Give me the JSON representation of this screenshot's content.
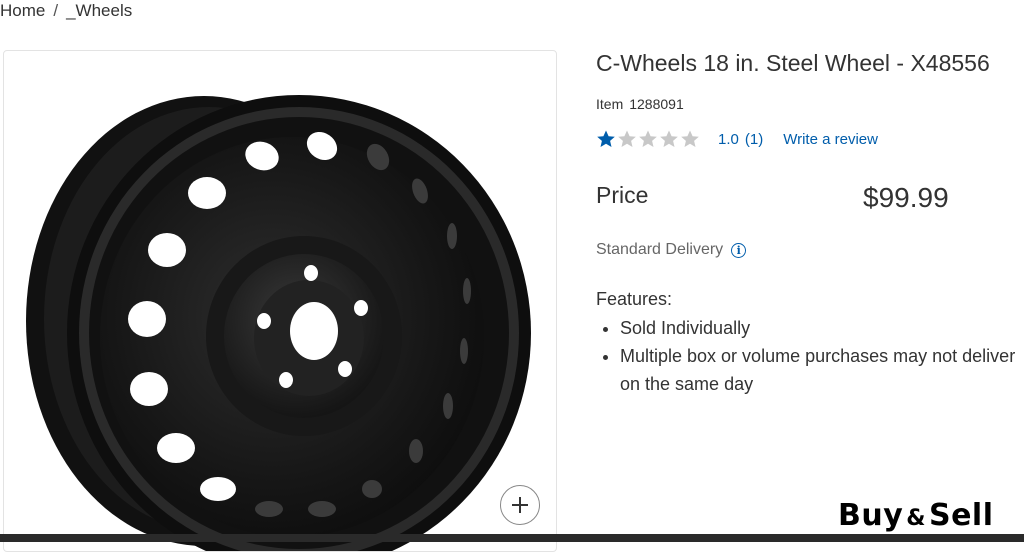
{
  "breadcrumb": {
    "home": "Home",
    "separator": "/",
    "category": "_Wheels"
  },
  "product": {
    "title": "C-Wheels 18 in. Steel Wheel - X48556",
    "item_label": "Item",
    "item_number": "1288091",
    "rating": {
      "value": 1.0,
      "display": "1.0",
      "count": "(1)",
      "max": 5,
      "write_review": "Write a review"
    },
    "price_label": "Price",
    "price": "$99.99",
    "delivery": "Standard Delivery",
    "features_label": "Features:",
    "features": [
      "Sold Individually",
      "Multiple box or volume purchases may not deliver on the same day"
    ]
  },
  "icons": {
    "zoom": "plus-icon",
    "info": "info-icon",
    "star": "star-icon"
  },
  "watermark": {
    "left": "Buy",
    "amp": "&",
    "right": "Sell"
  },
  "colors": {
    "link": "#005dab",
    "star_filled": "#005dab",
    "star_empty": "#c8c8c8",
    "wheel": "#1a1a1a"
  }
}
